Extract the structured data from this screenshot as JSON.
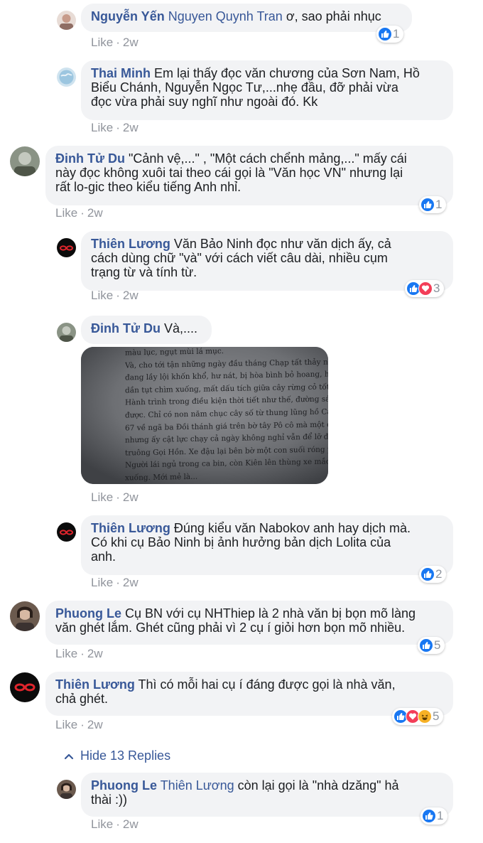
{
  "comments": [
    {
      "author": "Nguyễn Yến",
      "mention": "Nguyen Quynh Tran",
      "text": " ơ, sao phải nhục",
      "like": "Like",
      "time": "2w",
      "count": "1"
    },
    {
      "author": "Thai Minh",
      "lines": [
        "Em lại thấy đọc văn chương của Sơn Nam, Hồ",
        "Biểu Chánh, Nguyễn Ngọc Tư,...nhẹ đầu, đỡ phải vừa",
        "đọc vừa phải suy nghĩ như ngoài đó. Kk"
      ],
      "like": "Like",
      "time": "2w"
    },
    {
      "author": "Đinh Tử Du",
      "lines": [
        "\"Cảnh vệ,...\" , \"Một cách chểnh mảng,...\" mấy cái",
        "này đọc không xuôi tai theo cái gọi là \"Văn học VN\" nhưng lại",
        "rất lo-gic theo kiểu tiếng Anh nhỉ."
      ],
      "like": "Like",
      "time": "2w",
      "count": "1"
    },
    {
      "author": "Thiên Lương",
      "lines": [
        "Văn Bảo Ninh đọc như văn dịch ấy, cả",
        "cách dùng chữ \"và\" với cách viết câu dài, nhiều cụm",
        "trạng từ và tính từ."
      ],
      "like": "Like",
      "time": "2w",
      "count": "3"
    },
    {
      "author": "Đinh Tử Du",
      "text": "Và,....",
      "like": "Like",
      "time": "2w",
      "photo_lines": [
        "màu lục, ngụt mùi lá mục.",
        "Và, cho tới tận những ngày đầu tháng Chạp tất thảy như",
        "đang lầy lội khốn khổ, hư nát, bị hòa bình bỏ hoang, hầu",
        "dần tụt chìm xuống, mất dấu tích giữa cây rừng cỏ tốt um",
        "Hành trình trong điều kiện thời tiết như thế, đường sá r",
        "được. Chỉ có non năm chục cây số từ thung lũng hồ Cá S",
        "67 về ngã ba Đồi thánh giá trên bờ tây Pô cô mà một ch",
        "nhưng ấy cật lực chạy cả ngày không nghỉ vẫn để lỡ đ",
        "truông Gọi Hồn. Xe đậu lại bên bờ một con suối róng ph",
        "Người lái ngủ trong ca bin, còn Kiên lên thùng xe mắc v",
        "xuống. Mới mẻ là..."
      ]
    },
    {
      "author": "Thiên Lương",
      "lines": [
        "Đúng kiểu văn Nabokov anh hay dịch mà.",
        "Có khi cụ Bảo Ninh bị ảnh hưởng bản dịch Lolita của",
        "anh."
      ],
      "like": "Like",
      "time": "2w",
      "count": "2"
    },
    {
      "author": "Phuong Le",
      "lines": [
        "Cụ BN với cụ NHThiep là 2 nhà văn bị bọn mõ làng",
        "văn ghét lắm. Ghét cũng phải vì 2 cụ í giỏi hơn bọn mõ nhiều."
      ],
      "like": "Like",
      "time": "2w",
      "count": "5"
    },
    {
      "author": "Thiên Lương",
      "lines": [
        "Thì có mỗi hai cụ í đáng được gọi là nhà văn,",
        "chả ghét."
      ],
      "like": "Like",
      "time": "2w",
      "count": "5"
    },
    {
      "author": "Phuong Le",
      "mention": "Thiên Lương",
      "lines": [
        "còn lại gọi là \"nhà dzăng\" hả",
        "thài :))"
      ],
      "like": "Like",
      "time": "2w",
      "count": "1"
    }
  ],
  "hide_replies": "Hide 13 Replies",
  "colors": {
    "link": "#385898",
    "bubble": "#f2f3f5",
    "meta": "#90949c",
    "like_blue": "#1877f2",
    "love_red": "#f33e58",
    "haha_yellow": "#f7b125"
  }
}
